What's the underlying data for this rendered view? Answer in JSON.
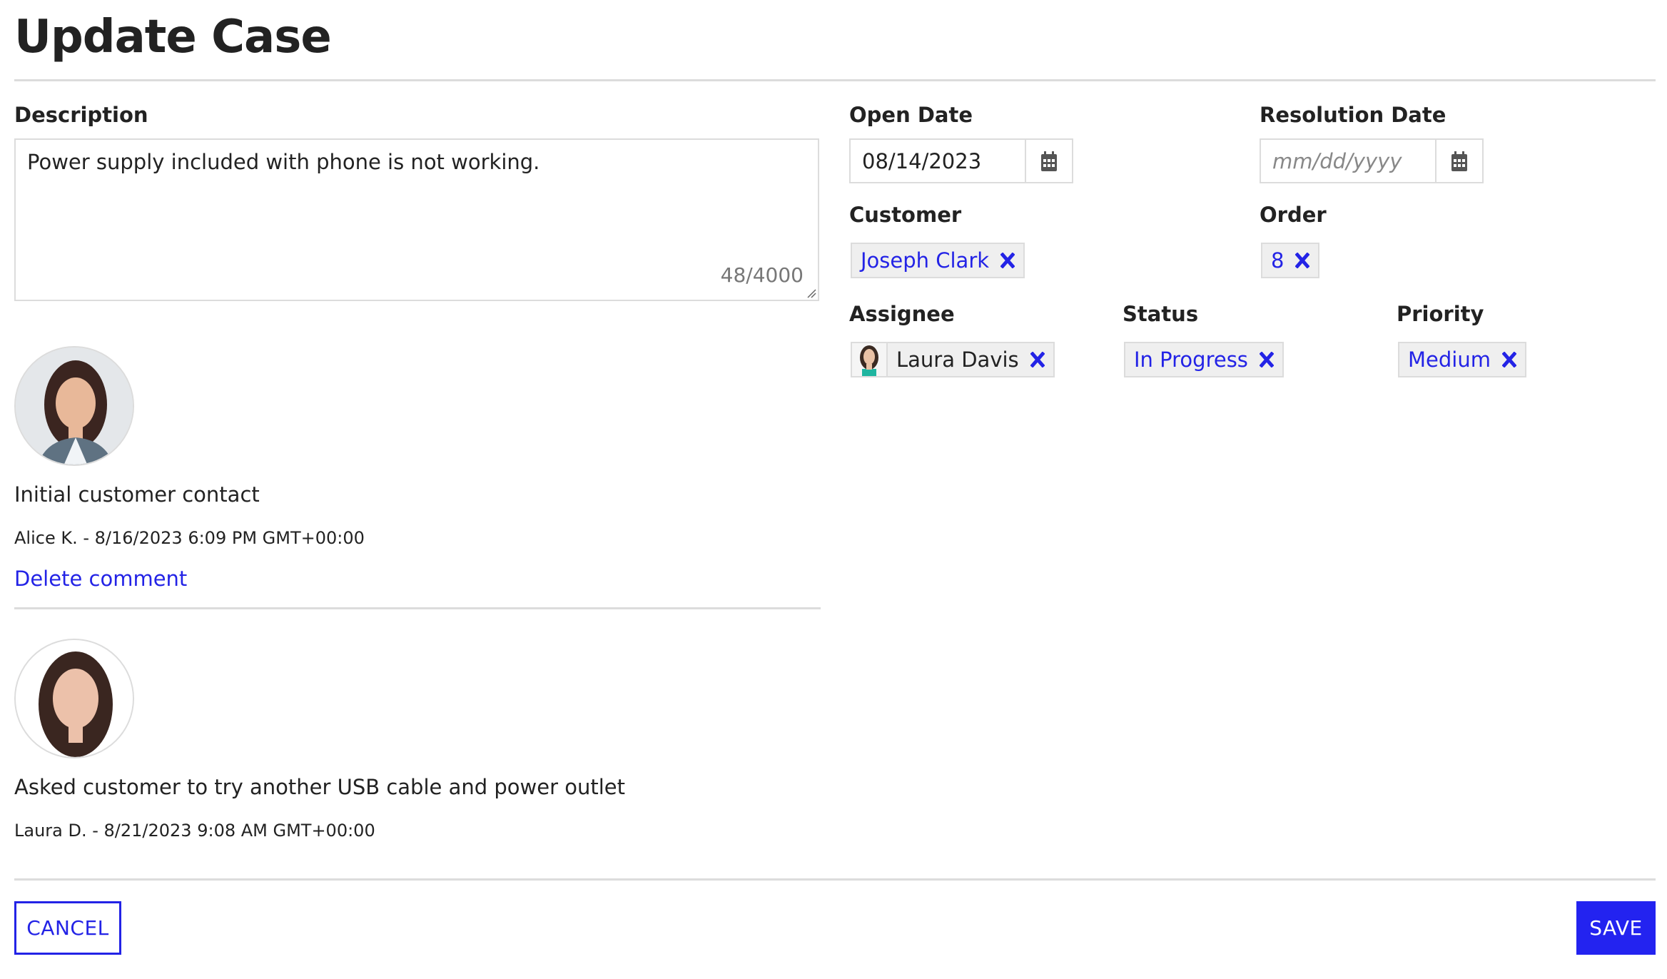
{
  "page": {
    "title": "Update Case"
  },
  "description": {
    "label": "Description",
    "value": "Power supply included with phone is not working.",
    "counter": "48/4000"
  },
  "open_date": {
    "label": "Open Date",
    "value": "08/14/2023",
    "icon": "calendar-icon"
  },
  "resolution_date": {
    "label": "Resolution Date",
    "placeholder": "mm/dd/yyyy",
    "icon": "calendar-icon"
  },
  "customer": {
    "label": "Customer",
    "value": "Joseph Clark"
  },
  "order": {
    "label": "Order",
    "value": "8"
  },
  "assignee": {
    "label": "Assignee",
    "value": "Laura Davis"
  },
  "status": {
    "label": "Status",
    "value": "In Progress"
  },
  "priority": {
    "label": "Priority",
    "value": "Medium"
  },
  "comments": [
    {
      "text": "Initial customer contact",
      "meta": "Alice K. - 8/16/2023 6:09 PM GMT+00:00",
      "delete_label": "Delete comment"
    },
    {
      "text": "Asked customer to try another USB cable and power outlet",
      "meta": "Laura D. - 8/21/2023 9:08 AM GMT+00:00"
    }
  ],
  "actions": {
    "cancel_label": "CANCEL",
    "save_label": "SAVE"
  },
  "colors": {
    "accent": "#2323e6",
    "save_bg": "#2323f0",
    "border": "#dcdcdc",
    "chip_bg": "#efefef"
  }
}
